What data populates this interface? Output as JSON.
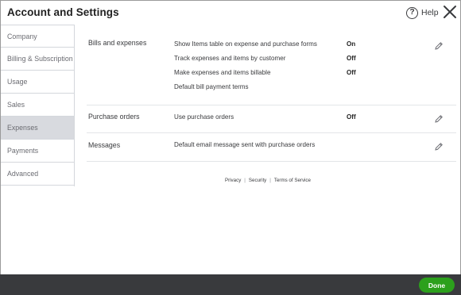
{
  "header": {
    "title": "Account and Settings",
    "help_label": "Help",
    "help_icon_glyph": "?"
  },
  "sidebar": {
    "items": [
      {
        "label": "Company",
        "active": false
      },
      {
        "label": "Billing & Subscription",
        "active": false
      },
      {
        "label": "Usage",
        "active": false
      },
      {
        "label": "Sales",
        "active": false
      },
      {
        "label": "Expenses",
        "active": true
      },
      {
        "label": "Payments",
        "active": false
      },
      {
        "label": "Advanced",
        "active": false
      }
    ]
  },
  "sections": {
    "bills": {
      "name": "Bills and expenses",
      "rows": [
        {
          "label": "Show Items table on expense and purchase forms",
          "value": "On"
        },
        {
          "label": "Track expenses and items by customer",
          "value": "Off"
        },
        {
          "label": "Make expenses and items billable",
          "value": "Off"
        },
        {
          "label": "Default bill payment terms",
          "value": ""
        }
      ]
    },
    "purchase_orders": {
      "name": "Purchase orders",
      "rows": [
        {
          "label": "Use purchase orders",
          "value": "Off"
        }
      ]
    },
    "messages": {
      "name": "Messages",
      "rows": [
        {
          "label": "Default email message sent with purchase orders",
          "value": ""
        }
      ]
    }
  },
  "footer": {
    "links": [
      "Privacy",
      "Security",
      "Terms of Service"
    ],
    "separator": "|"
  },
  "actions": {
    "done_label": "Done"
  },
  "colors": {
    "accent_green": "#2ca01c",
    "bottom_bar": "#393a3d",
    "active_sidebar": "#d8dadf"
  }
}
